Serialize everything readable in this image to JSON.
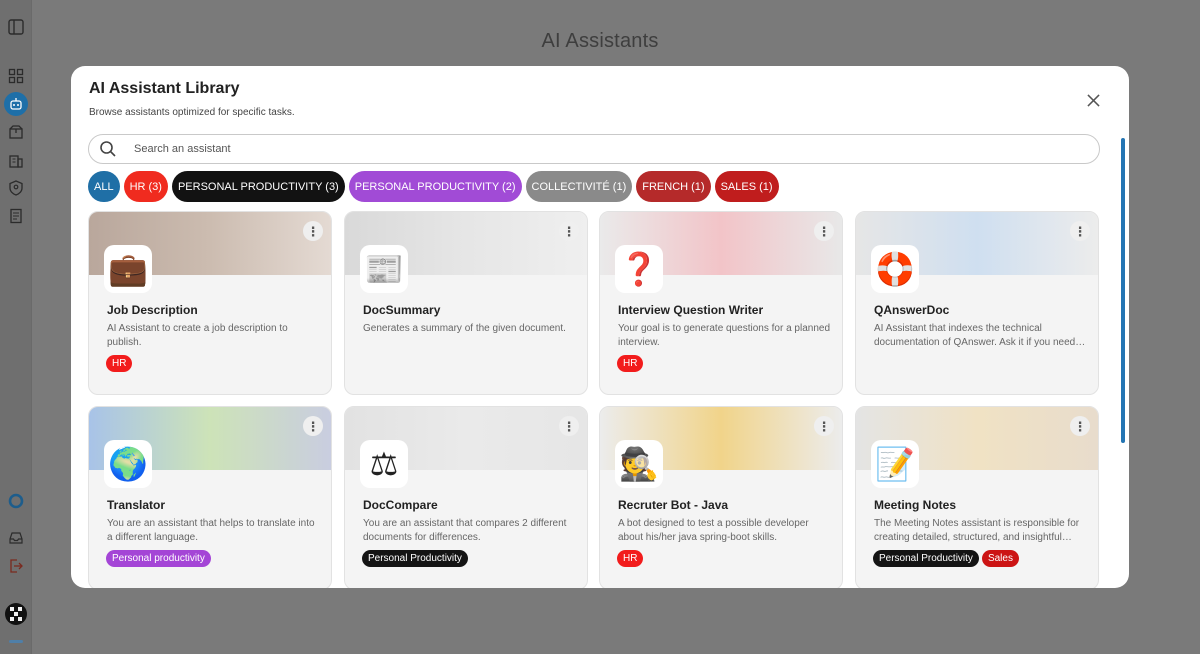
{
  "page": {
    "title": "AI Assistants"
  },
  "sidebar": {
    "icons": [
      "sidebar-toggle-icon",
      "grid-icon",
      "robot-icon",
      "box-icon",
      "building-icon",
      "shield-user-icon",
      "document-icon",
      "circle-logo-icon",
      "inbox-icon",
      "logout-icon",
      "user-avatar-icon"
    ]
  },
  "modal": {
    "title": "AI Assistant Library",
    "subtitle": "Browse assistants optimized for specific tasks.",
    "search_placeholder": "Search an assistant",
    "filters": [
      {
        "label": "ALL",
        "color": "#1f6fa6"
      },
      {
        "label": "HR (3)",
        "color": "#f02b1f"
      },
      {
        "label": "PERSONAL PRODUCTIVITY (3)",
        "color": "#121212"
      },
      {
        "label": "PERSONAL PRODUCTIVITY (2)",
        "color": "#a14bd6"
      },
      {
        "label": "COLLECTIVITÉ (1)",
        "color": "#8a8a8a"
      },
      {
        "label": "FRENCH (1)",
        "color": "#b52a2a"
      },
      {
        "label": "SALES (1)",
        "color": "#c01d1d"
      }
    ],
    "cards": [
      {
        "name": "Job Description",
        "desc": "AI Assistant to create a job description to publish.",
        "icon": "💼",
        "banner": [
          "#b9a79c",
          "#ccbcb0",
          "#e4dad3"
        ],
        "tags": [
          {
            "label": "HR",
            "color": "#f21c1c"
          }
        ]
      },
      {
        "name": "DocSummary",
        "desc": "Generates a summary of the given document.",
        "icon": "📰",
        "banner": [
          "#d9d9d9",
          "#e6e6e6",
          "#efefef"
        ],
        "tags": []
      },
      {
        "name": "Interview Question Writer",
        "desc": "Your goal is to generate questions for a planned interview.",
        "icon": "❓",
        "banner": [
          "#eaeaea",
          "#f2c4c8",
          "#e8e8e8"
        ],
        "tags": [
          {
            "label": "HR",
            "color": "#f21c1c"
          }
        ]
      },
      {
        "name": "QAnswerDoc",
        "desc": "AI Assistant that indexes the technical documentation of QAnswer. Ask it if you need help.",
        "icon": "🛟",
        "banner": [
          "#e6e6e6",
          "#cfdff0",
          "#ececec"
        ],
        "tags": []
      },
      {
        "name": "Translator",
        "desc": "You are an assistant that helps to translate into a different language.",
        "icon": "🌍",
        "banner": [
          "#a8c3e8",
          "#cde3b8",
          "#c9cde0"
        ],
        "tags": [
          {
            "label": "Personal productivity",
            "color": "#a445d6"
          }
        ]
      },
      {
        "name": "DocCompare",
        "desc": "You are an assistant that compares 2 different documents for differences.",
        "icon": "⚖",
        "banner": [
          "#e2e2e2",
          "#eaeaea",
          "#e6e6e6"
        ],
        "tags": [
          {
            "label": "Personal Productivity",
            "color": "#141414"
          }
        ]
      },
      {
        "name": "Recruter Bot - Java",
        "desc": "A bot designed to test a possible developer about his/her java spring-boot skills.",
        "icon": "🕵",
        "banner": [
          "#ececec",
          "#f1d48a",
          "#ececec"
        ],
        "tags": [
          {
            "label": "HR",
            "color": "#f21c1c"
          }
        ]
      },
      {
        "name": "Meeting Notes",
        "desc": "The Meeting Notes assistant is responsible for creating detailed, structured, and insightful notes.",
        "icon": "📝",
        "banner": [
          "#e4e4e4",
          "#f0e2c4",
          "#e8dccc"
        ],
        "tags": [
          {
            "label": "Personal Productivity",
            "color": "#141414"
          },
          {
            "label": "Sales",
            "color": "#cc1414"
          }
        ]
      }
    ]
  }
}
